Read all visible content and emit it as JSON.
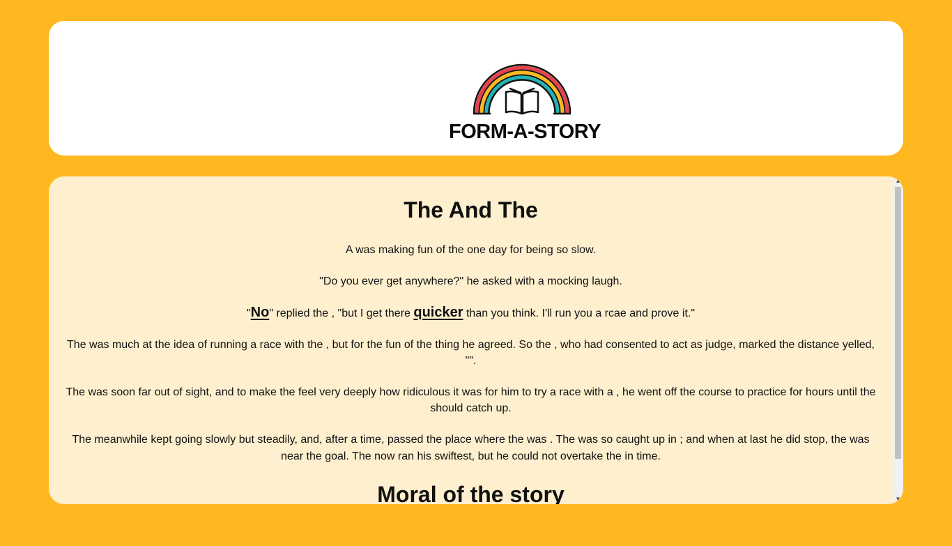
{
  "header": {
    "logo_text": "FORM-A-STORY",
    "logo_icon": "rainbow-book-icon",
    "logo_colors": [
      "#E8414B",
      "#FFB820",
      "#22B3B3"
    ]
  },
  "story": {
    "title": "The And The",
    "p1": "A was making fun of the one day for being so slow.",
    "p2": "\"Do you ever get anywhere?\" he asked with a mocking laugh.",
    "p3_quote_open": "\"",
    "p3_word1": "No",
    "p3_mid": "\" replied the , \"but I get there ",
    "p3_word2": "quicker",
    "p3_end": " than you think. I'll run you a rcae and prove it.\"",
    "p4": "The was much at the idea of running a race with the , but for the fun of the thing he agreed. So the , who had consented to act as judge, marked the distance yelled, \"\".",
    "p5": "The was soon far out of sight, and to make the feel very deeply how ridiculous it was for him to try a race with a , he went off the course to practice for hours until the should catch up.",
    "p6": "The meanwhile kept going slowly but steadily, and, after a time, passed the place where the was . The was so caught up in ; and when at last he did stop, the was near the goal. The now ran his swiftest, but he could not overtake the in time.",
    "moral_title": "Moral of the story"
  },
  "colors": {
    "page_background": "#FFB820",
    "header_card": "#FFFFFF",
    "story_card": "#FEEFCF"
  },
  "scrollbar": {
    "up_icon": "scroll-up-arrow-icon",
    "down_icon": "scroll-down-arrow-icon"
  }
}
